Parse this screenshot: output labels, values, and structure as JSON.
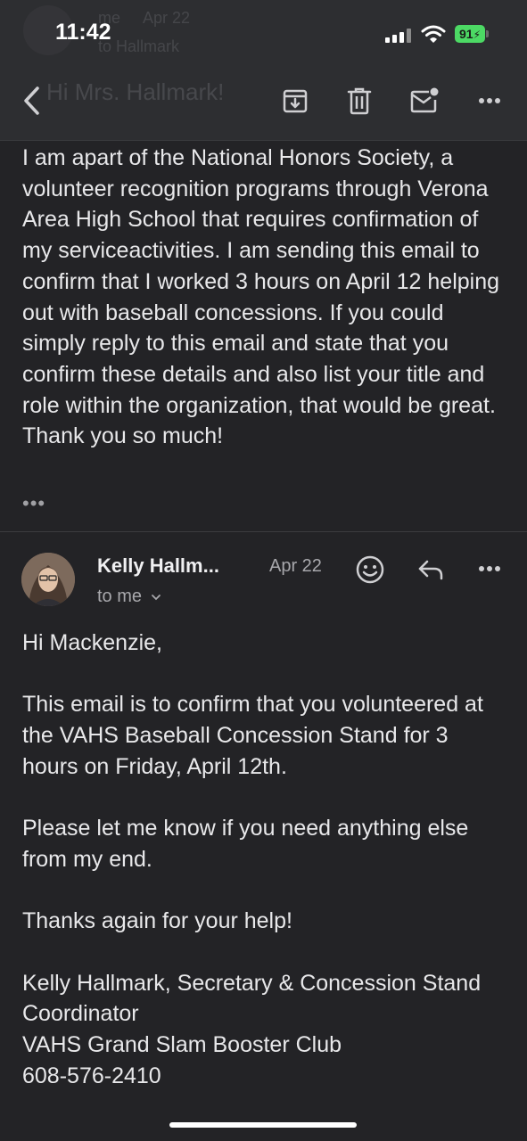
{
  "status_bar": {
    "time": "11:42",
    "battery": "91"
  },
  "background_ghost": {
    "sender": "me",
    "date": "Apr 22",
    "to": "to Hallmark",
    "title": "Hi Mrs. Hallmark!"
  },
  "toolbar": {
    "back_icon": "chevron-left-icon",
    "archive_icon": "archive-icon",
    "delete_icon": "trash-icon",
    "unread_icon": "mail-unread-icon",
    "more_icon": "more-horizontal-icon"
  },
  "first_message": {
    "body": "I am apart of the National Honors Society, a volunteer recognition programs through Verona Area High School that requires confirmation of my serviceactivities. I am sending this email to confirm that I worked 3 hours on April 12 helping out with baseball concessions. If you could simply reply to this email and state that you confirm these details and also list your title and role within the organization, that would be great. Thank you so much!",
    "ellipsis": "•••"
  },
  "reply": {
    "sender": "Kelly Hallm...",
    "date": "Apr 22",
    "recipient": "to me",
    "greeting": "Hi Mackenzie,",
    "paragraph1": "This email is to confirm that you volunteered at the VAHS Baseball Concession Stand for 3 hours on Friday, April 12th.",
    "paragraph2": "Please let me know if you need anything else from my end.",
    "paragraph3": "Thanks again for your help!",
    "signature_line1": "Kelly Hallmark, Secretary & Concession Stand Coordinator",
    "signature_line2": "VAHS Grand Slam Booster Club",
    "signature_line3": "608-576-2410"
  },
  "colors": {
    "background": "#232326",
    "toolbar": "#2d2e31",
    "text": "#e8e8ea",
    "muted": "#a8a8ac",
    "battery": "#4cd964"
  }
}
